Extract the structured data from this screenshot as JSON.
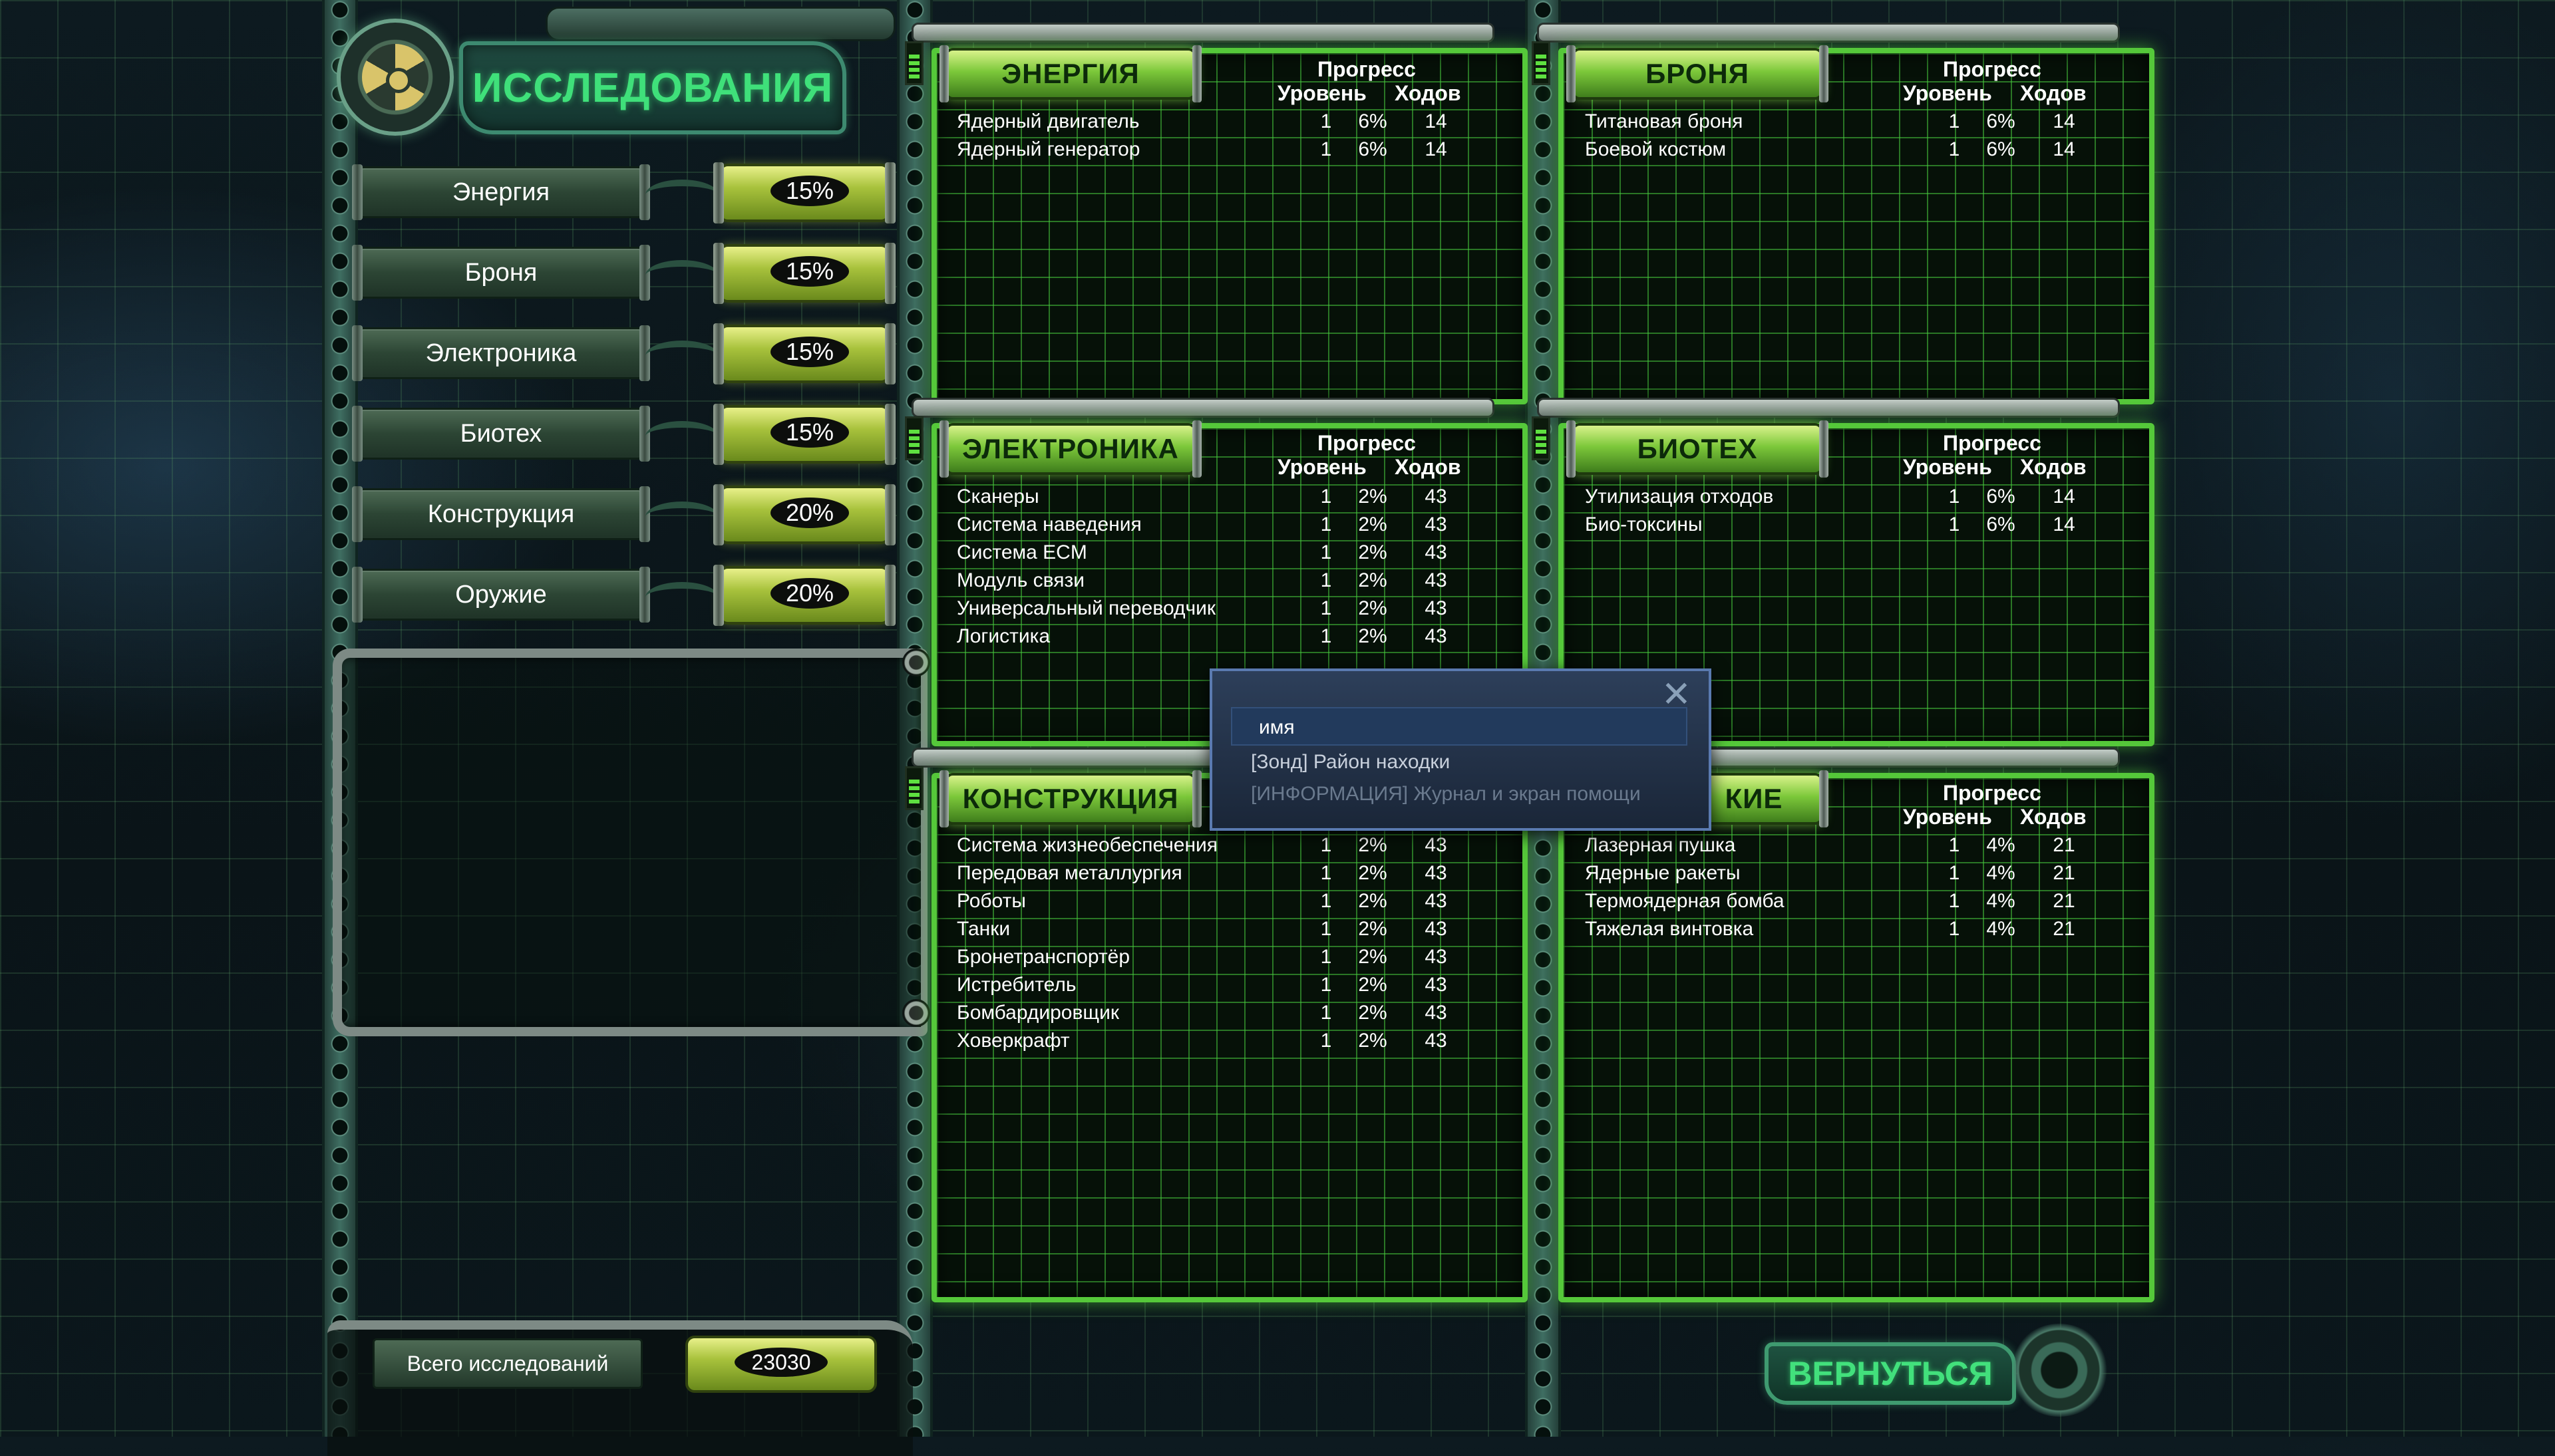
{
  "header": {
    "title": "ИССЛЕДОВАНИЯ",
    "logo_icon": "radiation-icon"
  },
  "categories": [
    {
      "label": "Энергия",
      "percent": "15%"
    },
    {
      "label": "Броня",
      "percent": "15%"
    },
    {
      "label": "Электроника",
      "percent": "15%"
    },
    {
      "label": "Биотех",
      "percent": "15%"
    },
    {
      "label": "Конструкция",
      "percent": "20%"
    },
    {
      "label": "Оружие",
      "percent": "20%"
    }
  ],
  "total": {
    "label": "Всего исследований",
    "value": "23030"
  },
  "columns": {
    "progress": "Прогресс",
    "level": "Уровень",
    "turns": "Ходов"
  },
  "panels": {
    "energy": {
      "title": "ЭНЕРГИЯ",
      "rows": [
        {
          "name": "Ядерный двигатель",
          "level": "1",
          "progress": "6%",
          "turns": "14"
        },
        {
          "name": "Ядерный генератор",
          "level": "1",
          "progress": "6%",
          "turns": "14"
        }
      ]
    },
    "armor": {
      "title": "БРОНЯ",
      "rows": [
        {
          "name": "Титановая броня",
          "level": "1",
          "progress": "6%",
          "turns": "14"
        },
        {
          "name": "Боевой костюм",
          "level": "1",
          "progress": "6%",
          "turns": "14"
        }
      ]
    },
    "electronics": {
      "title": "ЭЛЕКТРОНИКА",
      "rows": [
        {
          "name": "Сканеры",
          "level": "1",
          "progress": "2%",
          "turns": "43"
        },
        {
          "name": "Система наведения",
          "level": "1",
          "progress": "2%",
          "turns": "43"
        },
        {
          "name": "Система ECM",
          "level": "1",
          "progress": "2%",
          "turns": "43"
        },
        {
          "name": "Модуль связи",
          "level": "1",
          "progress": "2%",
          "turns": "43"
        },
        {
          "name": "Универсальный переводчик",
          "level": "1",
          "progress": "2%",
          "turns": "43"
        },
        {
          "name": "Логистика",
          "level": "1",
          "progress": "2%",
          "turns": "43"
        }
      ]
    },
    "biotech": {
      "title": "БИОТЕХ",
      "rows": [
        {
          "name": "Утилизация отходов",
          "level": "1",
          "progress": "6%",
          "turns": "14"
        },
        {
          "name": "Био-токсины",
          "level": "1",
          "progress": "6%",
          "turns": "14"
        }
      ]
    },
    "construction": {
      "title": "КОНСТРУКЦИЯ",
      "rows": [
        {
          "name": "Система жизнеобеспечения",
          "level": "1",
          "progress": "2%",
          "turns": "43"
        },
        {
          "name": "Передовая металлургия",
          "level": "1",
          "progress": "2%",
          "turns": "43"
        },
        {
          "name": "Роботы",
          "level": "1",
          "progress": "2%",
          "turns": "43"
        },
        {
          "name": "Танки",
          "level": "1",
          "progress": "2%",
          "turns": "43"
        },
        {
          "name": "Бронетранспортёр",
          "level": "1",
          "progress": "2%",
          "turns": "43"
        },
        {
          "name": "Истребитель",
          "level": "1",
          "progress": "2%",
          "turns": "43"
        },
        {
          "name": "Бомбардировщик",
          "level": "1",
          "progress": "2%",
          "turns": "43"
        },
        {
          "name": "Ховеркрафт",
          "level": "1",
          "progress": "2%",
          "turns": "43"
        }
      ]
    },
    "weapons": {
      "title": "КИЕ",
      "rows": [
        {
          "name": "Лазерная пушка",
          "level": "1",
          "progress": "4%",
          "turns": "21"
        },
        {
          "name": "Ядерные ракеты",
          "level": "1",
          "progress": "4%",
          "turns": "21"
        },
        {
          "name": "Термоядерная бомба",
          "level": "1",
          "progress": "4%",
          "turns": "21"
        },
        {
          "name": "Тяжелая винтовка",
          "level": "1",
          "progress": "4%",
          "turns": "21"
        }
      ]
    }
  },
  "popup": {
    "input_value": "имя",
    "items": [
      "[Зонд] Район находки",
      "[ИНФОРМАЦИЯ] Журнал и экран помощи"
    ],
    "close_icon": "close-icon"
  },
  "return_button": {
    "label": "ВЕРНУТЬСЯ",
    "icon": "gear-icon"
  },
  "colors": {
    "accent": "#55c83a",
    "title_green": "#3fe07a",
    "tube_yellow": "#a8c23c"
  }
}
